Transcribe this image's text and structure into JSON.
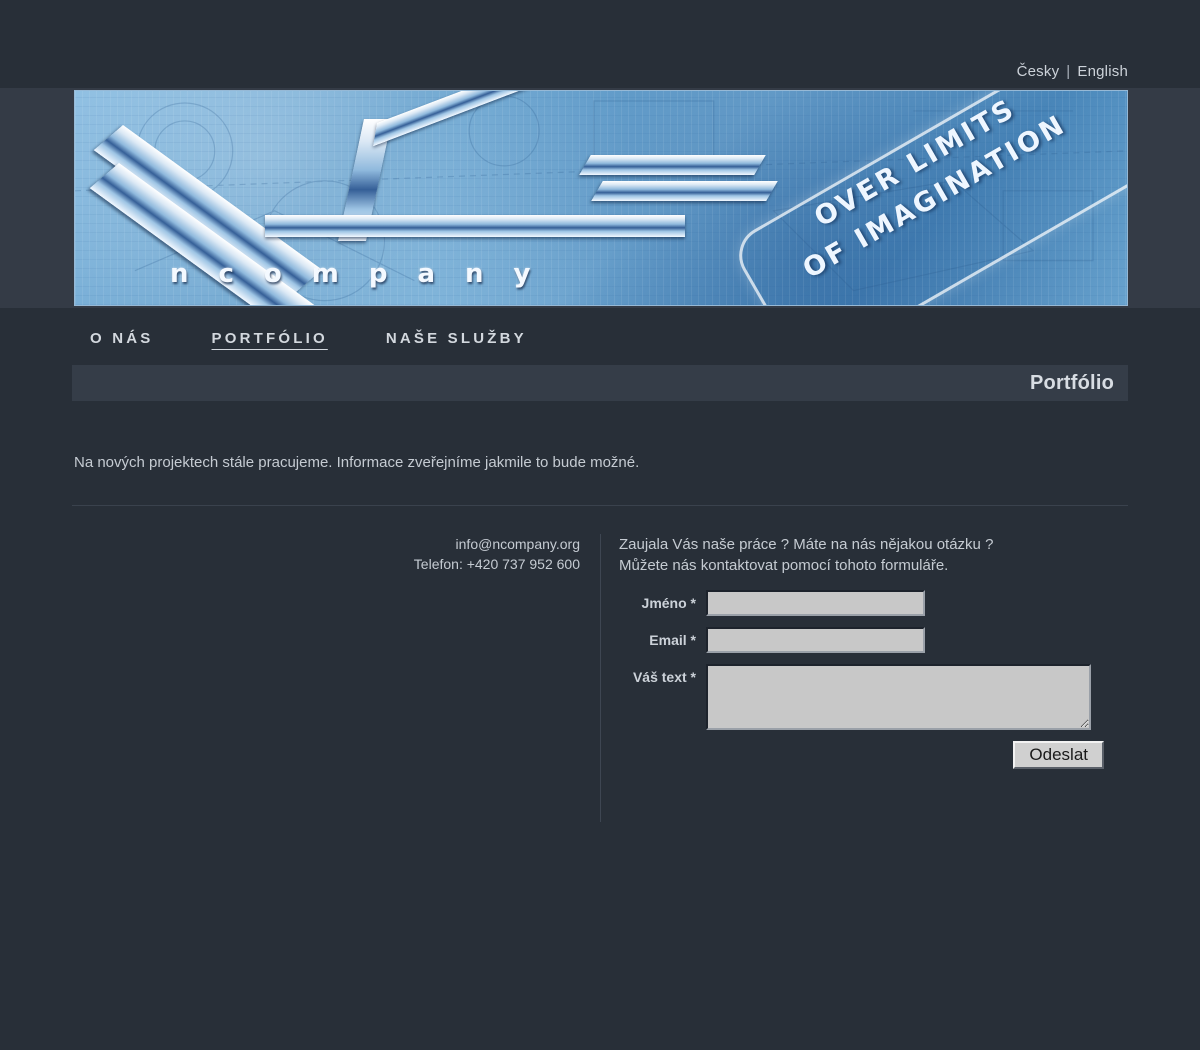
{
  "language_bar": {
    "czech_label": "Česky",
    "separator": "|",
    "english_label": "English"
  },
  "banner": {
    "logo_wordmark": "ncompany",
    "tagline": "OVER LIMITS\nOF IMAGINATION",
    "logo_alt": "ncompany-chrome-n-logo"
  },
  "nav": {
    "items": [
      {
        "label": "O NÁS",
        "active": false
      },
      {
        "label": "PORTFÓLIO",
        "active": true
      },
      {
        "label": "NAŠE SLUŽBY",
        "active": false
      }
    ]
  },
  "page": {
    "title": "Portfólio",
    "intro": "Na nových projektech stále pracujeme. Informace zveřejníme jakmile to bude možné."
  },
  "contact": {
    "email": "info@ncompany.org",
    "phone": "Telefon: +420 737 952 600"
  },
  "form": {
    "intro": "Zaujala Vás naše práce ? Máte na nás nějakou otázku ?\nMůžete nás kontaktovat pomocí tohoto formuláře.",
    "name_label": "Jméno *",
    "name_value": "",
    "email_label": "Email *",
    "email_value": "",
    "message_label": "Váš text *",
    "message_value": "",
    "submit_label": "Odeslat"
  },
  "colors": {
    "page_background": "#282f38",
    "banner_row_background": "#343b46",
    "title_bar_background": "#353d48",
    "text": "#c7ccd3",
    "input_background": "#c8c8c8",
    "banner_blue": "#5d9ccb"
  }
}
